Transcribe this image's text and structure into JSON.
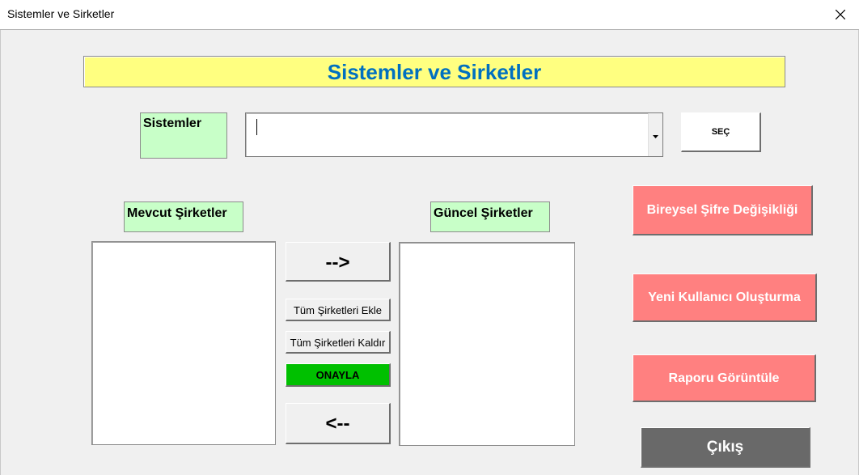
{
  "window": {
    "title": "Sistemler ve Sirketler"
  },
  "form": {
    "header": "Sistemler ve Sirketler",
    "sistemler_label": "Sistemler",
    "sistemler_value": "",
    "sec_button": "SEÇ",
    "mevcut_label": "Mevcut Şirketler",
    "guncel_label": "Güncel Şirketler",
    "add_button": "-->",
    "add_all_button": "Tüm Şirketleri Ekle",
    "remove_all_button": "Tüm Şirketleri Kaldır",
    "approve_button": "ONAYLA",
    "remove_button": "<--",
    "password_button": "Bireysel Şifre Değişikliği",
    "new_user_button": "Yeni Kullanıcı Oluşturma",
    "report_button": "Raporu Görüntüle",
    "exit_button": "Çıkış"
  },
  "colors": {
    "header_bg": "#ffff80",
    "header_text": "#0070c0",
    "label_bg": "#c8ffc8",
    "approve_bg": "#00c000",
    "action_bg": "#ff8080",
    "exit_bg": "#696969"
  }
}
